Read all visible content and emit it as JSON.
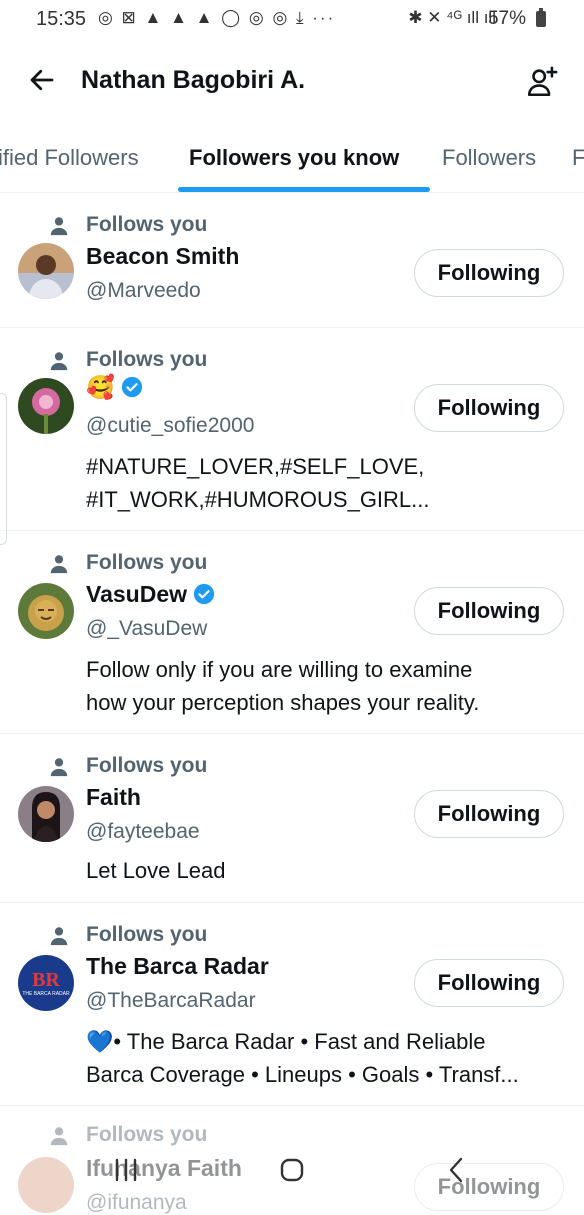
{
  "status_bar": {
    "time": "15:35",
    "left_icons": "◎ ⊠ ▲ ▲ ▲ ◯ ◎ ◎ ⤓  ···",
    "right_icons": "✱ ✕ ⁴ᴳ ıll ıll",
    "battery": "57%"
  },
  "header": {
    "title": "Nathan Bagobiri A."
  },
  "tabs": [
    {
      "label": "ified Followers"
    },
    {
      "label": "Followers you know"
    },
    {
      "label": "Followers"
    },
    {
      "label": "F"
    }
  ],
  "follows_label": "Follows you",
  "button_label": "Following",
  "accent_color": "#1d9bf0",
  "users": [
    {
      "name": "Beacon Smith",
      "handle": "@Marveedo",
      "verified": false,
      "bio": []
    },
    {
      "name": "🥰",
      "handle": "@cutie_sofie2000",
      "verified": true,
      "bio": [
        "#NATURE_LOVER,#SELF_LOVE,",
        "#IT_WORK,#HUMOROUS_GIRL..."
      ]
    },
    {
      "name": "VasuDew",
      "handle": "@_VasuDew",
      "verified": true,
      "bio": [
        "Follow only if you are willing to examine",
        "how your perception shapes your reality."
      ]
    },
    {
      "name": "Faith",
      "handle": "@fayteebae",
      "verified": false,
      "bio": [
        "Let Love Lead"
      ]
    },
    {
      "name": "The Barca Radar",
      "handle": "@TheBarcaRadar",
      "verified": false,
      "avatar_text": "BR",
      "avatar_subtext": "THE BARCA RADAR",
      "bio": [
        "💙• The Barca Radar • Fast and Reliable",
        "Barca Coverage • Lineups • Goals • Transf..."
      ]
    },
    {
      "name": "Ifunanya Faith",
      "handle": "@ifunanya",
      "verified": false,
      "bio": []
    }
  ]
}
